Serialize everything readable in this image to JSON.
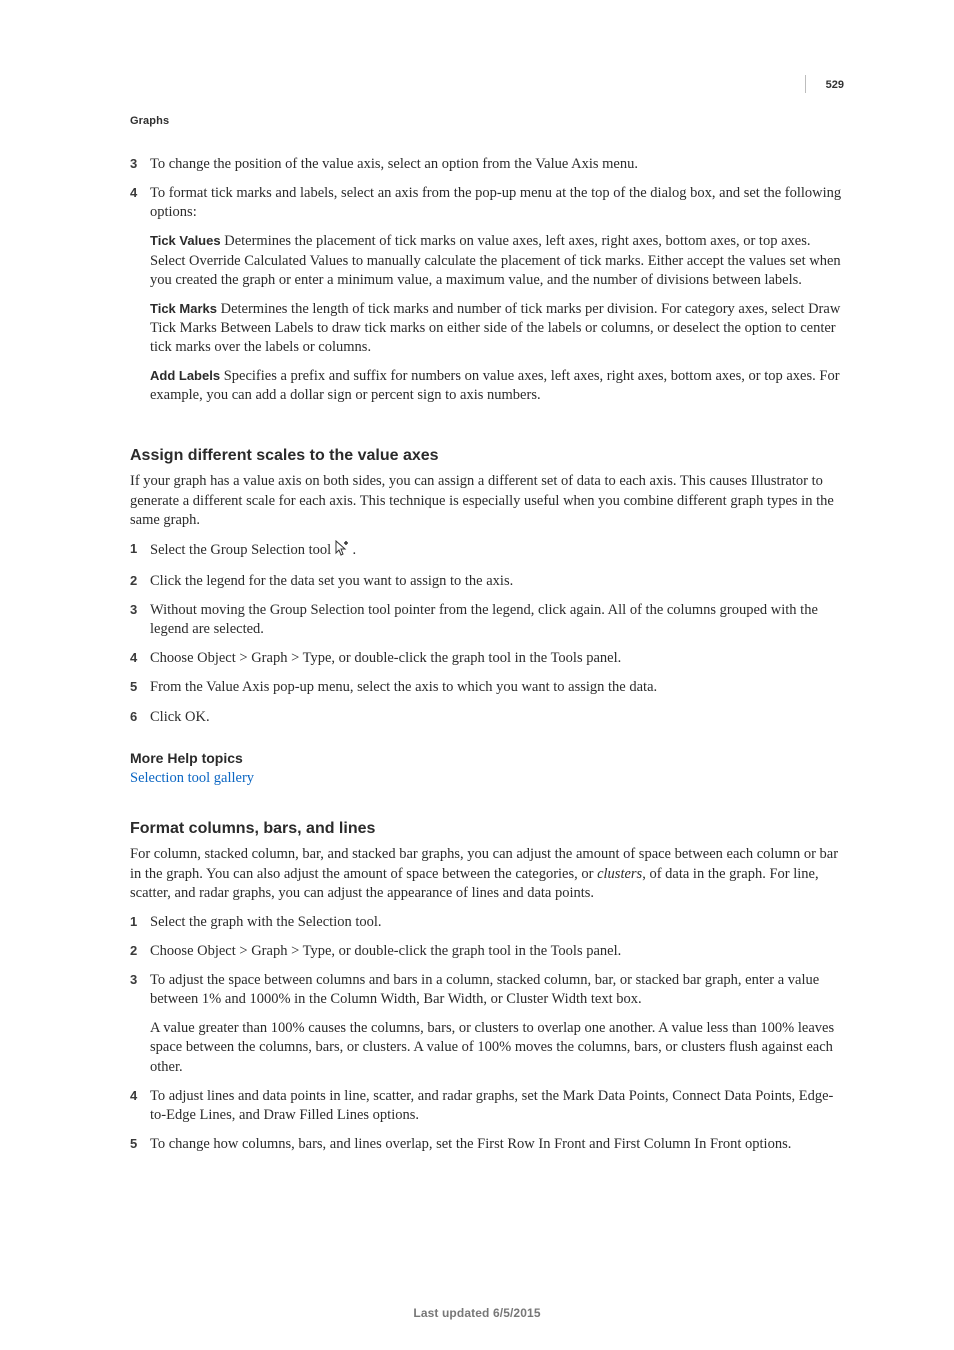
{
  "pageNumber": "529",
  "chapter": "Graphs",
  "list1": {
    "n3": "3",
    "n4": "4",
    "t3": "To change the position of the value axis, select an option from the Value Axis menu.",
    "t4": "To format tick marks and labels, select an axis from the pop-up menu at the top of the dialog box, and set the following options:"
  },
  "defs": {
    "tickValues": {
      "label": "Tick Values",
      "text": " Determines the placement of tick marks on value axes, left axes, right axes, bottom axes, or top axes. Select Override Calculated Values to manually calculate the placement of tick marks. Either accept the values set when you created the graph or enter a minimum value, a maximum value, and the number of divisions between labels."
    },
    "tickMarks": {
      "label": "Tick Marks",
      "text": " Determines the length of tick marks and number of tick marks per division. For category axes, select Draw Tick Marks Between Labels to draw tick marks on either side of the labels or columns, or deselect the option to center tick marks over the labels or columns."
    },
    "addLabels": {
      "label": "Add Labels",
      "text": " Specifies a prefix and suffix for numbers on value axes, left axes, right axes, bottom axes, or top axes. For example, you can add a dollar sign or percent sign to axis numbers."
    }
  },
  "assign": {
    "heading": "Assign different scales to the value axes",
    "intro": "If your graph has a value axis on both sides, you can assign a different set of data to each axis. This causes Illustrator to generate a different scale for each axis. This technique is especially useful when you combine different graph types in the same graph.",
    "n1": "1",
    "n2": "2",
    "n3": "3",
    "n4": "4",
    "n5": "5",
    "n6": "6",
    "t1a": "Select the Group Selection tool ",
    "t1b": " .",
    "t2": "Click the legend for the data set you want to assign to the axis.",
    "t3": "Without moving the Group Selection tool pointer from the legend, click again. All of the columns grouped with the legend are selected.",
    "t4": "Choose Object > Graph > Type, or double-click the graph tool in the Tools panel.",
    "t5": "From the Value Axis pop-up menu, select the axis to which you want to assign the data.",
    "t6": "Click OK."
  },
  "moreHelp": {
    "heading": "More Help topics",
    "link": "Selection tool gallery"
  },
  "format": {
    "heading": "Format columns, bars, and lines",
    "intro_a": "For column, stacked column, bar, and stacked bar graphs, you can adjust the amount of space between each column or bar in the graph. You can also adjust the amount of space between the categories, or ",
    "intro_em": "clusters",
    "intro_b": ", of data in the graph. For line, scatter, and radar graphs, you can adjust the appearance of lines and data points.",
    "n1": "1",
    "n2": "2",
    "n3": "3",
    "n4": "4",
    "n5": "5",
    "t1": "Select the graph with the Selection tool.",
    "t2": "Choose Object > Graph > Type, or double-click the graph tool in the Tools panel.",
    "t3a": "To adjust the space between columns and bars in a column, stacked column, bar, or stacked bar graph, enter a value between 1% and 1000% in the Column Width, Bar Width, or Cluster Width text box.",
    "t3b": "A value greater than 100% causes the columns, bars, or clusters to overlap one another. A value less than 100% leaves space between the columns, bars, or clusters. A value of 100% moves the columns, bars, or clusters flush against each other.",
    "t4": "To adjust lines and data points in line, scatter, and radar graphs, set the Mark Data Points, Connect Data Points, Edge-to-Edge Lines, and Draw Filled Lines options.",
    "t5": "To change how columns, bars, and lines overlap, set the First Row In Front and First Column In Front options."
  },
  "footer": "Last updated 6/5/2015"
}
